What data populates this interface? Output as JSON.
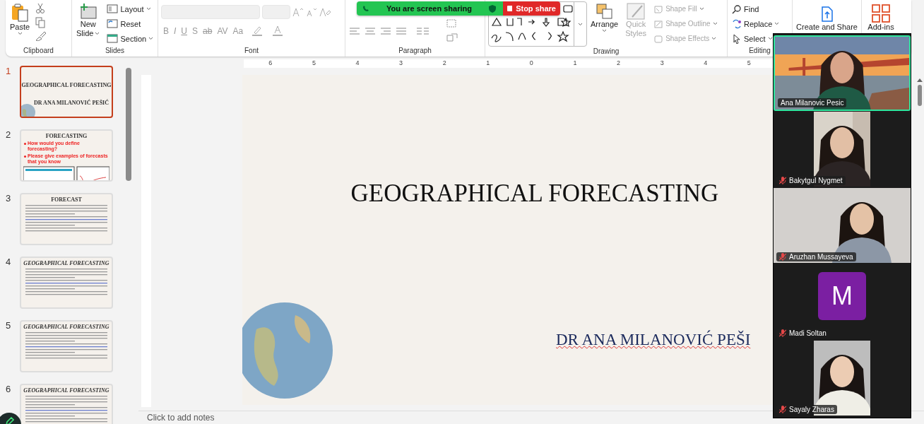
{
  "share_bar": {
    "message": "You are screen sharing",
    "stop_label": "Stop share"
  },
  "clipboard": {
    "paste": "Paste",
    "label": "Clipboard"
  },
  "slides_group": {
    "new_slide": "New Slide",
    "items": [
      "Layout",
      "Reset",
      "Section"
    ],
    "label": "Slides"
  },
  "font": {
    "format_buttons": [
      "B",
      "I",
      "U",
      "S",
      "ab",
      "AV",
      "Aa"
    ],
    "disabled": true,
    "label": "Font"
  },
  "paragraph": {
    "label": "Paragraph"
  },
  "drawing": {
    "arrange": "Arrange",
    "quick_styles": "Quick Styles",
    "quick_styles_disabled": true,
    "shape_items": [
      {
        "label": "Shape Fill",
        "disabled": true
      },
      {
        "label": "Shape Outline",
        "disabled": true
      },
      {
        "label": "Shape Effects",
        "disabled": true
      }
    ],
    "label": "Drawing"
  },
  "editing": {
    "items": [
      "Find",
      "Replace",
      "Select"
    ],
    "label": "Editing"
  },
  "create_share": "Create and Share",
  "add_ins": "Add-ins",
  "ruler": {
    "labels": [
      "6",
      "5",
      "4",
      "3",
      "2",
      "1",
      "0",
      "1",
      "2",
      "3",
      "4",
      "5"
    ]
  },
  "thumbnails": [
    {
      "number": "1",
      "selected": true,
      "kind": "title",
      "title": "GEOGRAPHICAL FORECASTING",
      "subtitle": "DR ANA MILANOVIĆ PEŠIĆ"
    },
    {
      "number": "2",
      "selected": false,
      "kind": "questions",
      "title": "FORECASTING",
      "bullets": [
        "How would you define forecasting?",
        "Please give examples of forecasts that you know"
      ]
    },
    {
      "number": "3",
      "selected": false,
      "kind": "text",
      "title": "FORECAST"
    },
    {
      "number": "4",
      "selected": false,
      "kind": "text",
      "title": "GEOGRAPHICAL FORECASTING"
    },
    {
      "number": "5",
      "selected": false,
      "kind": "text",
      "title": "GEOGRAPHICAL FORECASTING"
    },
    {
      "number": "6",
      "selected": false,
      "kind": "text",
      "title": "GEOGRAPHICAL FORECASTING"
    }
  ],
  "slide": {
    "title": "GEOGRAPHICAL FORECASTING",
    "subtitle": "DR ANA MILANOVIĆ PEŠI"
  },
  "notes_placeholder": "Click to add notes",
  "participants": [
    {
      "name": "Ana Milanovic Pesic",
      "muted": false,
      "speaking": true,
      "kind": "landscape"
    },
    {
      "name": "Bakytgul Nygmet",
      "muted": true,
      "speaking": false,
      "kind": "portrait"
    },
    {
      "name": "Aruzhan Mussayeva",
      "muted": true,
      "speaking": false,
      "kind": "landscape"
    },
    {
      "name": "Madi Soltan",
      "muted": true,
      "speaking": false,
      "kind": "avatar",
      "initial": "M",
      "color": "#7b1fa2"
    },
    {
      "name": "Sayaly Zharas",
      "muted": true,
      "speaking": false,
      "kind": "portrait"
    }
  ]
}
